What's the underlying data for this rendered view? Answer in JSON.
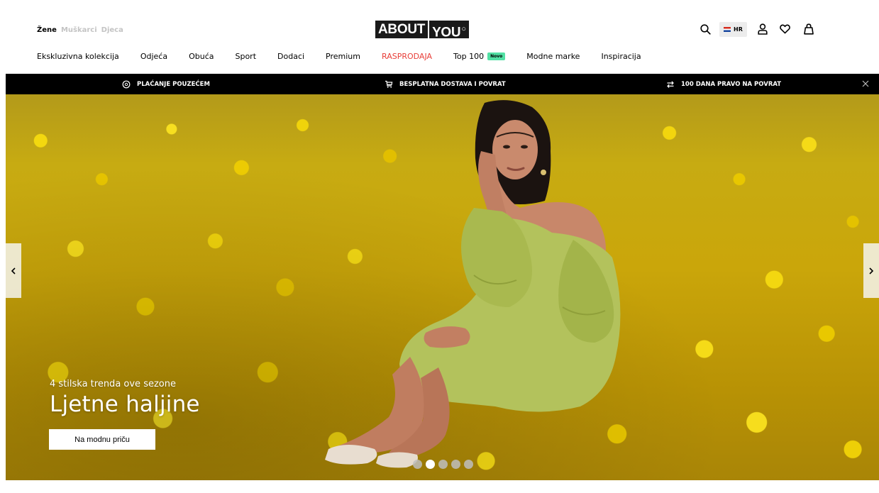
{
  "header": {
    "gender_tabs": [
      "Žene",
      "Muškarci",
      "Djeca"
    ],
    "logo": {
      "part1": "ABOUT",
      "part2": "YOU"
    },
    "country": "HR",
    "nav": [
      {
        "label": "Ekskluzivna kolekcija"
      },
      {
        "label": "Odjeća"
      },
      {
        "label": "Obuća"
      },
      {
        "label": "Sport"
      },
      {
        "label": "Dodaci"
      },
      {
        "label": "Premium"
      },
      {
        "label": "RASPRODAJA"
      },
      {
        "label": "Top 100",
        "badge": "Novo"
      },
      {
        "label": "Modne marke"
      },
      {
        "label": "Inspiracija"
      }
    ],
    "icons": [
      "search-icon",
      "user-icon",
      "heart-icon",
      "bag-icon"
    ]
  },
  "usp_bar": {
    "items": [
      "PLAĆANJE POUZEĆEM",
      "BESPLATNA DOSTAVA I POVRAT",
      "100 DANA PRAVO NA POVRAT"
    ]
  },
  "hero": {
    "subtitle": "4 stilska trenda ove sezone",
    "title": "Ljetne haljine",
    "button": "Na modnu priču",
    "slide_count": 5,
    "active_slide": 2
  },
  "colors": {
    "sale": "#e83e38",
    "badge": "#52e0a4",
    "usp_bg": "#000000"
  }
}
